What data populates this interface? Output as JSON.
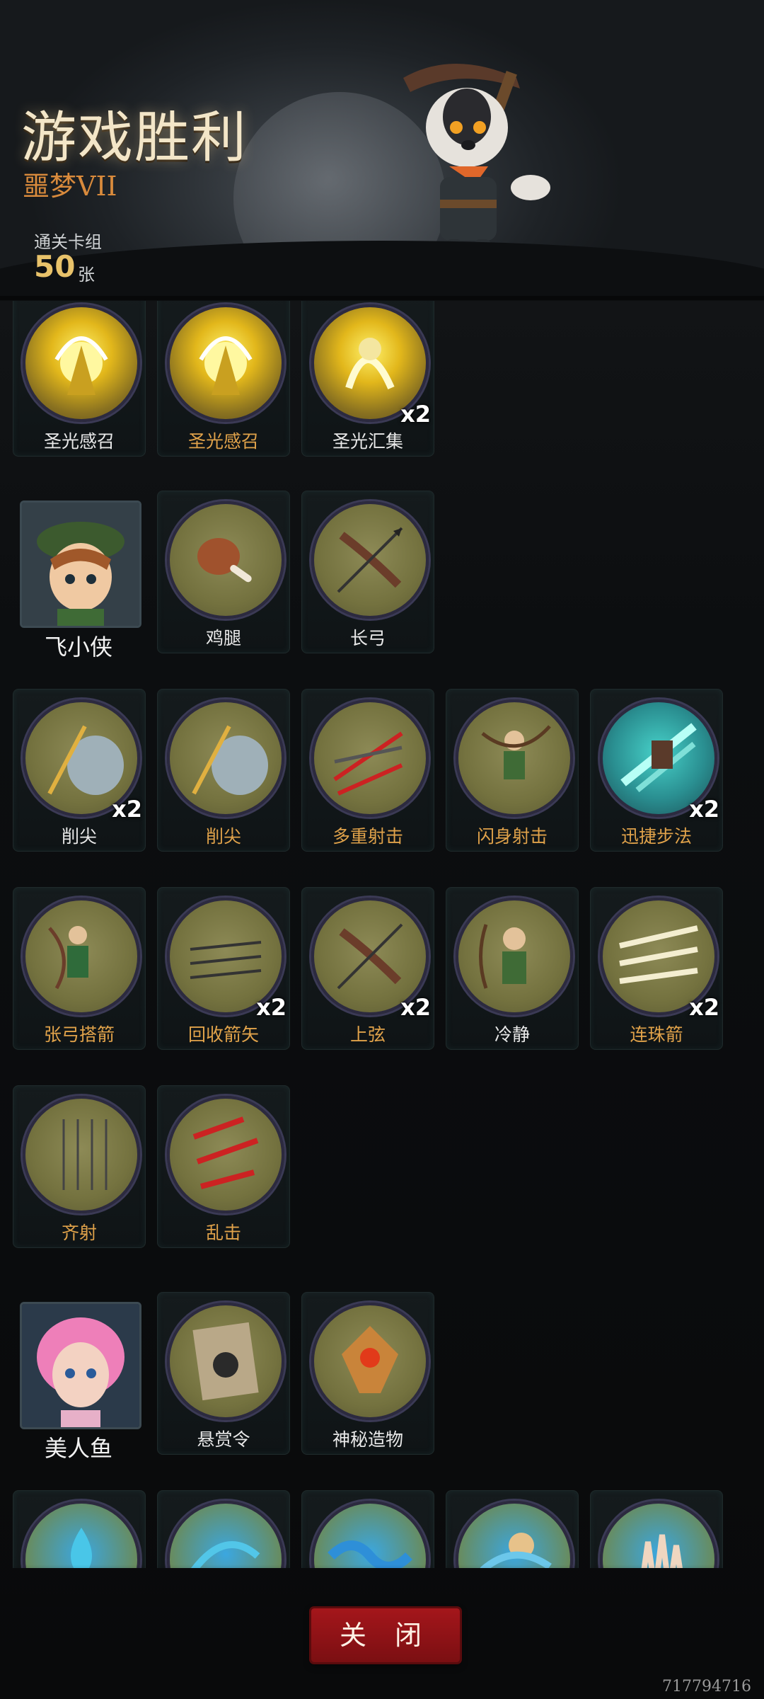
{
  "header": {
    "title": "游戏胜利",
    "subtitle": "噩梦VII",
    "deck_label": "通关卡组",
    "deck_count": "50",
    "deck_unit": "张"
  },
  "groups": [
    {
      "cards": [
        {
          "label": "圣光感召",
          "label_color": "white",
          "art": "holy-light-icon"
        },
        {
          "label": "圣光感召",
          "label_color": "gold",
          "art": "holy-light-icon"
        },
        {
          "label": "圣光汇集",
          "label_color": "white",
          "art": "holy-gather-icon",
          "multiplier": "x2"
        }
      ]
    },
    {
      "character": {
        "name": "飞小侠",
        "art": "archer-portrait"
      },
      "cards": [
        {
          "label": "鸡腿",
          "label_color": "white",
          "art": "drumstick-icon"
        },
        {
          "label": "长弓",
          "label_color": "white",
          "art": "longbow-icon"
        }
      ]
    },
    {
      "cards": [
        {
          "label": "削尖",
          "label_color": "white",
          "art": "sharpen-icon",
          "multiplier": "x2"
        },
        {
          "label": "削尖",
          "label_color": "gold",
          "art": "sharpen-icon"
        },
        {
          "label": "多重射击",
          "label_color": "gold",
          "art": "multishot-icon"
        },
        {
          "label": "闪身射击",
          "label_color": "gold",
          "art": "dodge-shot-icon"
        },
        {
          "label": "迅捷步法",
          "label_color": "gold",
          "art": "swift-step-icon",
          "multiplier": "x2"
        }
      ]
    },
    {
      "cards": [
        {
          "label": "张弓搭箭",
          "label_color": "gold",
          "art": "draw-bow-icon"
        },
        {
          "label": "回收箭矢",
          "label_color": "gold",
          "art": "recover-arrows-icon",
          "multiplier": "x2"
        },
        {
          "label": "上弦",
          "label_color": "gold",
          "art": "string-bow-icon",
          "multiplier": "x2"
        },
        {
          "label": "冷静",
          "label_color": "white",
          "art": "calm-icon"
        },
        {
          "label": "连珠箭",
          "label_color": "gold",
          "art": "chain-arrows-icon",
          "multiplier": "x2"
        }
      ]
    },
    {
      "cards": [
        {
          "label": "齐射",
          "label_color": "gold",
          "art": "volley-icon"
        },
        {
          "label": "乱击",
          "label_color": "gold",
          "art": "frenzy-strike-icon"
        }
      ]
    },
    {
      "character": {
        "name": "美人鱼",
        "art": "mermaid-portrait"
      },
      "cards": [
        {
          "label": "悬赏令",
          "label_color": "white",
          "art": "wanted-poster-icon"
        },
        {
          "label": "神秘造物",
          "label_color": "white",
          "art": "mystic-artifact-icon"
        }
      ]
    },
    {
      "cards": [
        {
          "label": "",
          "art": "water-drop-icon"
        },
        {
          "label": "",
          "art": "water-sprout-icon"
        },
        {
          "label": "",
          "art": "water-wave-icon"
        },
        {
          "label": "",
          "art": "water-spirit-icon"
        },
        {
          "label": "",
          "art": "water-hand-icon"
        }
      ]
    }
  ],
  "close_button": "关 闭",
  "watermark": "717794716",
  "colors": {
    "gold_label": "#e0a24a",
    "close_red": "#a4161b",
    "title": "#f3e6c8"
  }
}
